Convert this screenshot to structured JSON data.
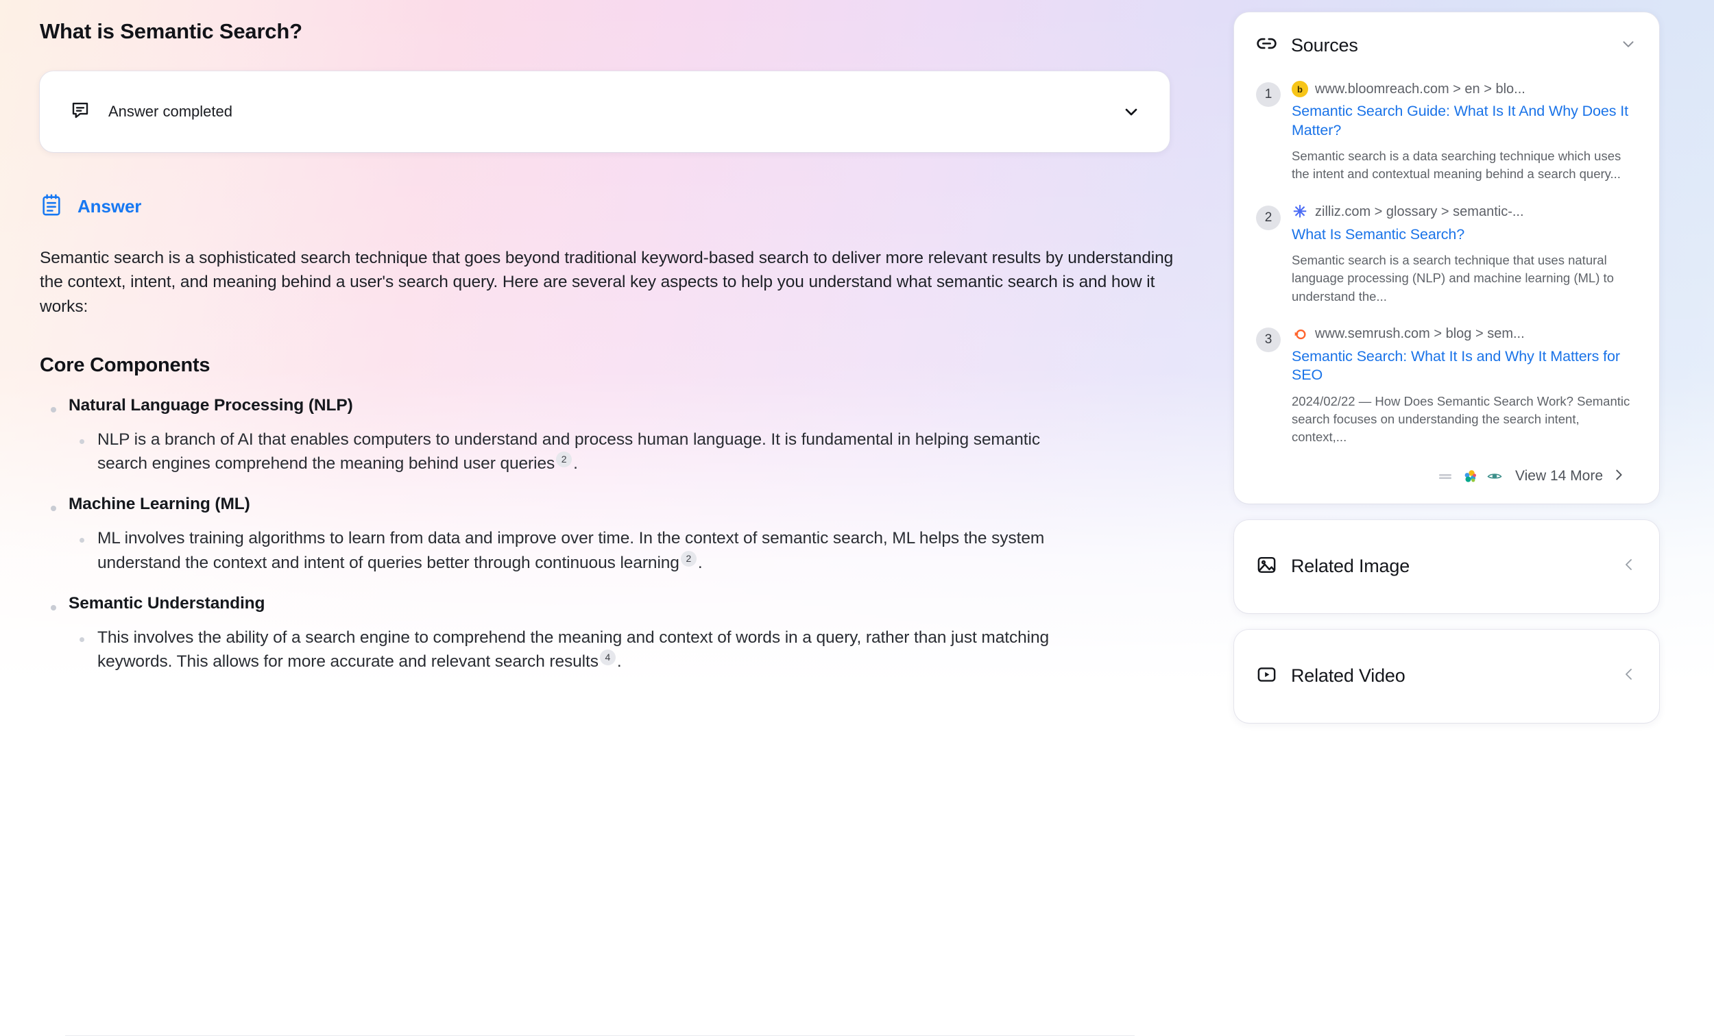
{
  "page": {
    "title": "What is Semantic Search?"
  },
  "status": {
    "icon": "chat-bubble-icon",
    "label": "Answer completed",
    "chevron": "chevron-down-icon"
  },
  "answer": {
    "icon": "notepad-icon",
    "label": "Answer",
    "intro": "Semantic search is a sophisticated search technique that goes beyond traditional keyword-based search to deliver more relevant results by understanding the context, intent, and meaning behind a user's search query. Here are several key aspects to help you understand what semantic search is and how it works:",
    "section_heading": "Core Components",
    "items": [
      {
        "title": "Natural Language Processing (NLP)",
        "text_before": "NLP is a branch of AI that enables computers to understand and process human language. It is fundamental in helping semantic search engines comprehend the meaning behind user queries",
        "citation": "2",
        "text_after": "."
      },
      {
        "title": "Machine Learning (ML)",
        "text_before": "ML involves training algorithms to learn from data and improve over time. In the context of semantic search, ML helps the system understand the context and intent of queries better through continuous learning",
        "citation": "2",
        "text_after": "."
      },
      {
        "title": "Semantic Understanding",
        "text_before": "This involves the ability of a search engine to comprehend the meaning and context of words in a query, rather than just matching keywords. This allows for more accurate and relevant search results",
        "citation": "4",
        "text_after": "."
      }
    ]
  },
  "sources": {
    "icon": "link-icon",
    "title": "Sources",
    "collapse_icon": "chevron-down-icon",
    "items": [
      {
        "number": "1",
        "favicon": "bloomreach-favicon",
        "favicon_letter": "b",
        "url": "www.bloomreach.com > en > blo...",
        "title": "Semantic Search Guide: What Is It And Why Does It Matter?",
        "snippet": "Semantic search is a data searching technique which uses the intent and contextual meaning behind a search query..."
      },
      {
        "number": "2",
        "favicon": "zilliz-favicon",
        "favicon_letter": "✳",
        "url": "zilliz.com > glossary > semantic-...",
        "title": "What Is Semantic Search?",
        "snippet": "Semantic search is a search technique that uses natural language processing (NLP) and machine learning (ML) to understand the..."
      },
      {
        "number": "3",
        "favicon": "semrush-favicon",
        "favicon_letter": "",
        "url": "www.semrush.com > blog > sem...",
        "title": "Semantic Search: What It Is and Why It Matters for SEO",
        "snippet": "2024/02/22 — How Does Semantic Search Work? Semantic search focuses on understanding the search intent, context,..."
      }
    ],
    "view_more_label": "View 14 More",
    "view_more_chevron": "chevron-right-icon",
    "mini_icons": [
      "lines-icon",
      "elastic-favicon",
      "eye-favicon"
    ]
  },
  "related_image": {
    "icon": "image-icon",
    "title": "Related Image",
    "collapse_icon": "chevron-left-icon"
  },
  "related_video": {
    "icon": "video-play-icon",
    "title": "Related Video",
    "collapse_icon": "chevron-left-icon"
  },
  "colors": {
    "accent_blue": "#1778f2",
    "link_blue": "#1a73e8",
    "text_dark": "#111318",
    "text_muted": "#5f6369",
    "card_bg": "#ffffff",
    "citation_bg": "#e6e7ec"
  }
}
